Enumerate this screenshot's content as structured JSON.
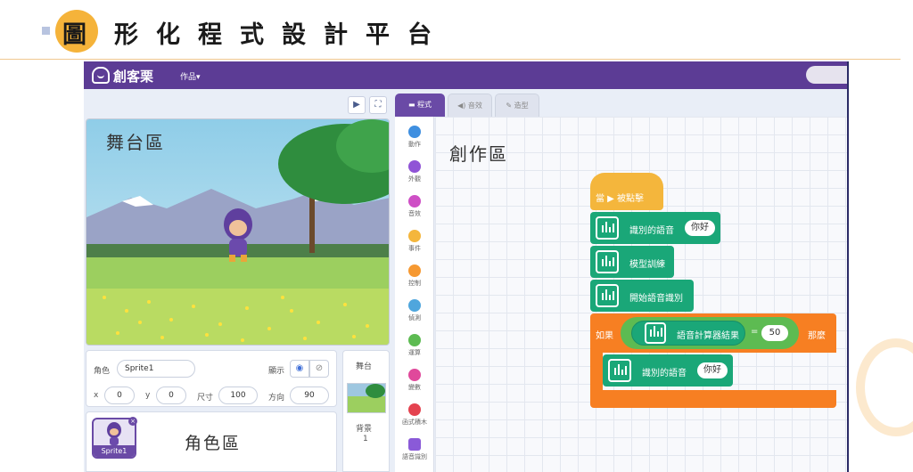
{
  "slide": {
    "title_first_char": "圖",
    "title_rest": "形化程式設計平台"
  },
  "app": {
    "logo_text": "創客栗",
    "menu_works": "作品▾"
  },
  "stage": {
    "label": "舞台區",
    "play_icon": "▶",
    "fullscreen_icon": "⛶"
  },
  "sprite_info": {
    "role_label": "角色",
    "role_name": "Sprite1",
    "show_label": "顯示",
    "x_label": "x",
    "x_value": "0",
    "y_label": "y",
    "y_value": "0",
    "size_label": "尺寸",
    "size_value": "100",
    "direction_label": "方向",
    "direction_value": "90"
  },
  "sprite_list": {
    "thumb_label": "Sprite1",
    "area_label": "角色區"
  },
  "stage_panel": {
    "title": "舞台",
    "backdrop_label": "背景",
    "backdrop_count": "1"
  },
  "tabs": [
    {
      "label": "▬ 程式"
    },
    {
      "label": "◀) 音效"
    },
    {
      "label": "✎ 造型"
    }
  ],
  "categories": [
    {
      "label": "動作",
      "color": "#3f8fe0"
    },
    {
      "label": "外觀",
      "color": "#9054d6"
    },
    {
      "label": "音效",
      "color": "#ce4fc5"
    },
    {
      "label": "事件",
      "color": "#f4b63c"
    },
    {
      "label": "控制",
      "color": "#f69932"
    },
    {
      "label": "偵測",
      "color": "#4fa6dd"
    },
    {
      "label": "運算",
      "color": "#5dbb52"
    },
    {
      "label": "變數",
      "color": "#e0499b"
    },
    {
      "label": "函式積木",
      "color": "#e4424f"
    },
    {
      "label": "語音識別",
      "color": "#8a5ad8"
    }
  ],
  "workspace": {
    "label": "創作區",
    "event_block": "當 ▶ 被點擊",
    "speech_result_label": "識別的語音",
    "speech_result_value": "你好",
    "train_model": "模型訓練",
    "start_recognition": "開始語音識別",
    "if_label": "如果",
    "counter_label": "語音計算器結果",
    "equals": "=",
    "compare_value": "50",
    "then_label": "那麼",
    "inner_speech_label": "識別的語音",
    "inner_speech_value": "你好"
  }
}
